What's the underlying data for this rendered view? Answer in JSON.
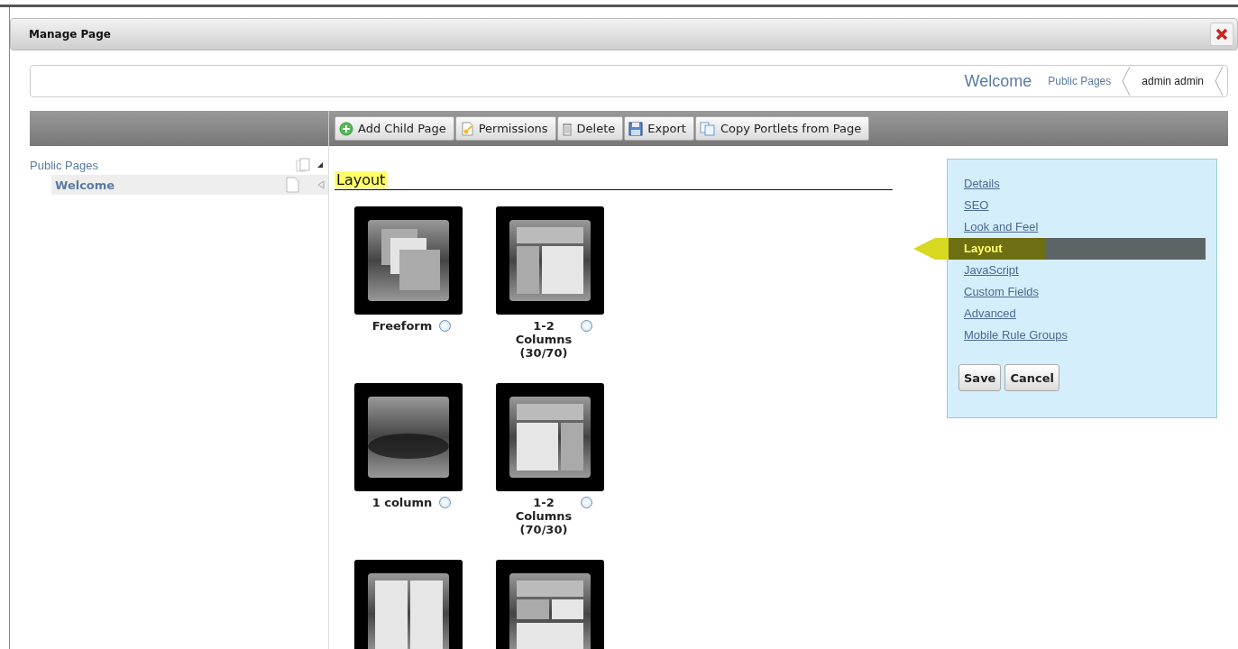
{
  "dialog": {
    "title": "Manage Page"
  },
  "breadcrumb": [
    "Welcome",
    "Public Pages",
    "admin admin"
  ],
  "toolbar": [
    {
      "label": "Add Child Page",
      "kind": "add"
    },
    {
      "label": "Permissions",
      "kind": "permissions"
    },
    {
      "label": "Delete",
      "kind": "delete"
    },
    {
      "label": "Export",
      "kind": "export"
    },
    {
      "label": "Copy Portlets from Page",
      "kind": "copy"
    }
  ],
  "tree": [
    {
      "label": "Public Pages",
      "selected": false,
      "children": [
        {
          "label": "Welcome",
          "selected": true
        }
      ]
    }
  ],
  "section_title": "Layout",
  "layouts": [
    {
      "kind": "freeform",
      "label": "Freeform",
      "selected": false
    },
    {
      "kind": "narrowwide",
      "label": "1-2 Columns (30/70)",
      "selected": false
    },
    {
      "kind": "single",
      "label": "1 column",
      "selected": false
    },
    {
      "kind": "widenarrow",
      "label": "1-2 Columns (70/30)",
      "selected": false
    },
    {
      "kind": "halves"
    },
    {
      "kind": "mixed"
    }
  ],
  "nav": [
    {
      "label": "Details",
      "selected": false
    },
    {
      "label": "SEO",
      "selected": false
    },
    {
      "label": "Look and Feel",
      "selected": false
    },
    {
      "label": "Layout",
      "selected": true
    },
    {
      "label": "JavaScript",
      "selected": false
    },
    {
      "label": "Custom Fields",
      "selected": false
    },
    {
      "label": "Advanced",
      "selected": false
    },
    {
      "label": "Mobile Rule Groups",
      "selected": false
    }
  ],
  "buttons": [
    "Save",
    "Cancel"
  ]
}
